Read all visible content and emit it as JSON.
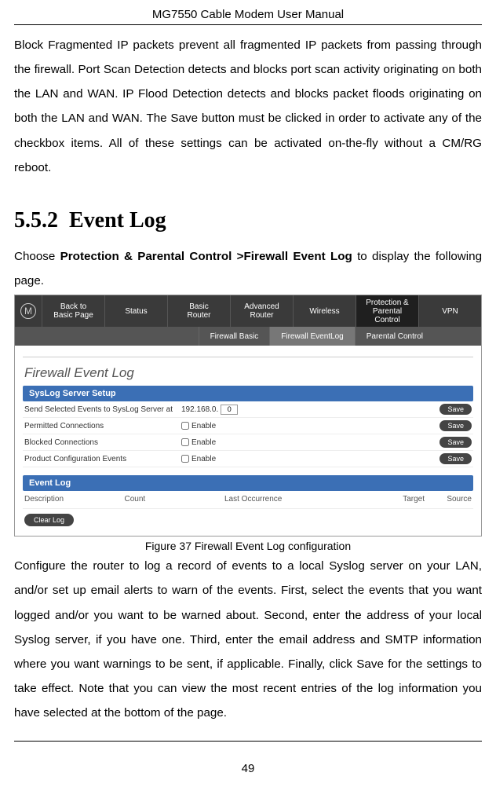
{
  "doc_title": "MG7550 Cable Modem User Manual",
  "para1": "Block Fragmented IP packets prevent all fragmented IP packets from passing through the firewall.  Port Scan Detection detects and blocks port scan activity originating on both the LAN and WAN. IP Flood Detection detects and blocks packet floods originating on both the LAN and WAN. The Save button must be clicked in order to activate any of the checkbox items. All of these settings can be activated on-the-fly without a CM/RG reboot.",
  "section_number": "5.5.2",
  "section_title": "Event Log",
  "nav_line_pre": "Choose ",
  "nav_path": "Protection & Parental Control >Firewall Event Log",
  "nav_line_post": " to display the following page.",
  "ui": {
    "nav": {
      "items": [
        {
          "l1": "Back to",
          "l2": "Basic Page"
        },
        {
          "l1": "Status",
          "l2": ""
        },
        {
          "l1": "Basic",
          "l2": "Router"
        },
        {
          "l1": "Advanced",
          "l2": "Router"
        },
        {
          "l1": "Wireless",
          "l2": ""
        },
        {
          "l1": "Protection &",
          "l2": "Parental Control"
        },
        {
          "l1": "VPN",
          "l2": ""
        }
      ]
    },
    "subnav": {
      "items": [
        {
          "label": "Firewall Basic"
        },
        {
          "label": "Firewall EventLog"
        },
        {
          "label": "Parental Control"
        }
      ]
    },
    "heading": "Firewall Event Log",
    "syslog": {
      "bar": "SysLog Server Setup",
      "rows": [
        {
          "label": "Send Selected Events to SysLog Server at",
          "type": "ip",
          "ip_prefix": "192.168.0.",
          "ip_last": "0"
        },
        {
          "label": "Permitted Connections",
          "type": "chk",
          "text": "Enable"
        },
        {
          "label": "Blocked Connections",
          "type": "chk",
          "text": "Enable"
        },
        {
          "label": "Product Configuration Events",
          "type": "chk",
          "text": "Enable"
        }
      ],
      "save_label": "Save"
    },
    "eventlog": {
      "bar": "Event Log",
      "cols": [
        "Description",
        "Count",
        "Last Occurrence",
        "Target",
        "Source"
      ],
      "clear_label": "Clear Log"
    }
  },
  "figure_caption": "Figure 37 Firewall Event Log configuration",
  "para2": "Configure the router to log a record of events to a local Syslog server on your LAN, and/or set up email alerts to warn of the events. First, select the events that you want logged and/or you want to be warned about. Second, enter the address of your local Syslog server, if you have one. Third, enter the email address and SMTP information where you want warnings to be sent, if applicable. Finally, click Save for the settings to take effect. Note that you can view the most recent entries of the log information you have selected at the bottom of the page.",
  "page_number": "49"
}
